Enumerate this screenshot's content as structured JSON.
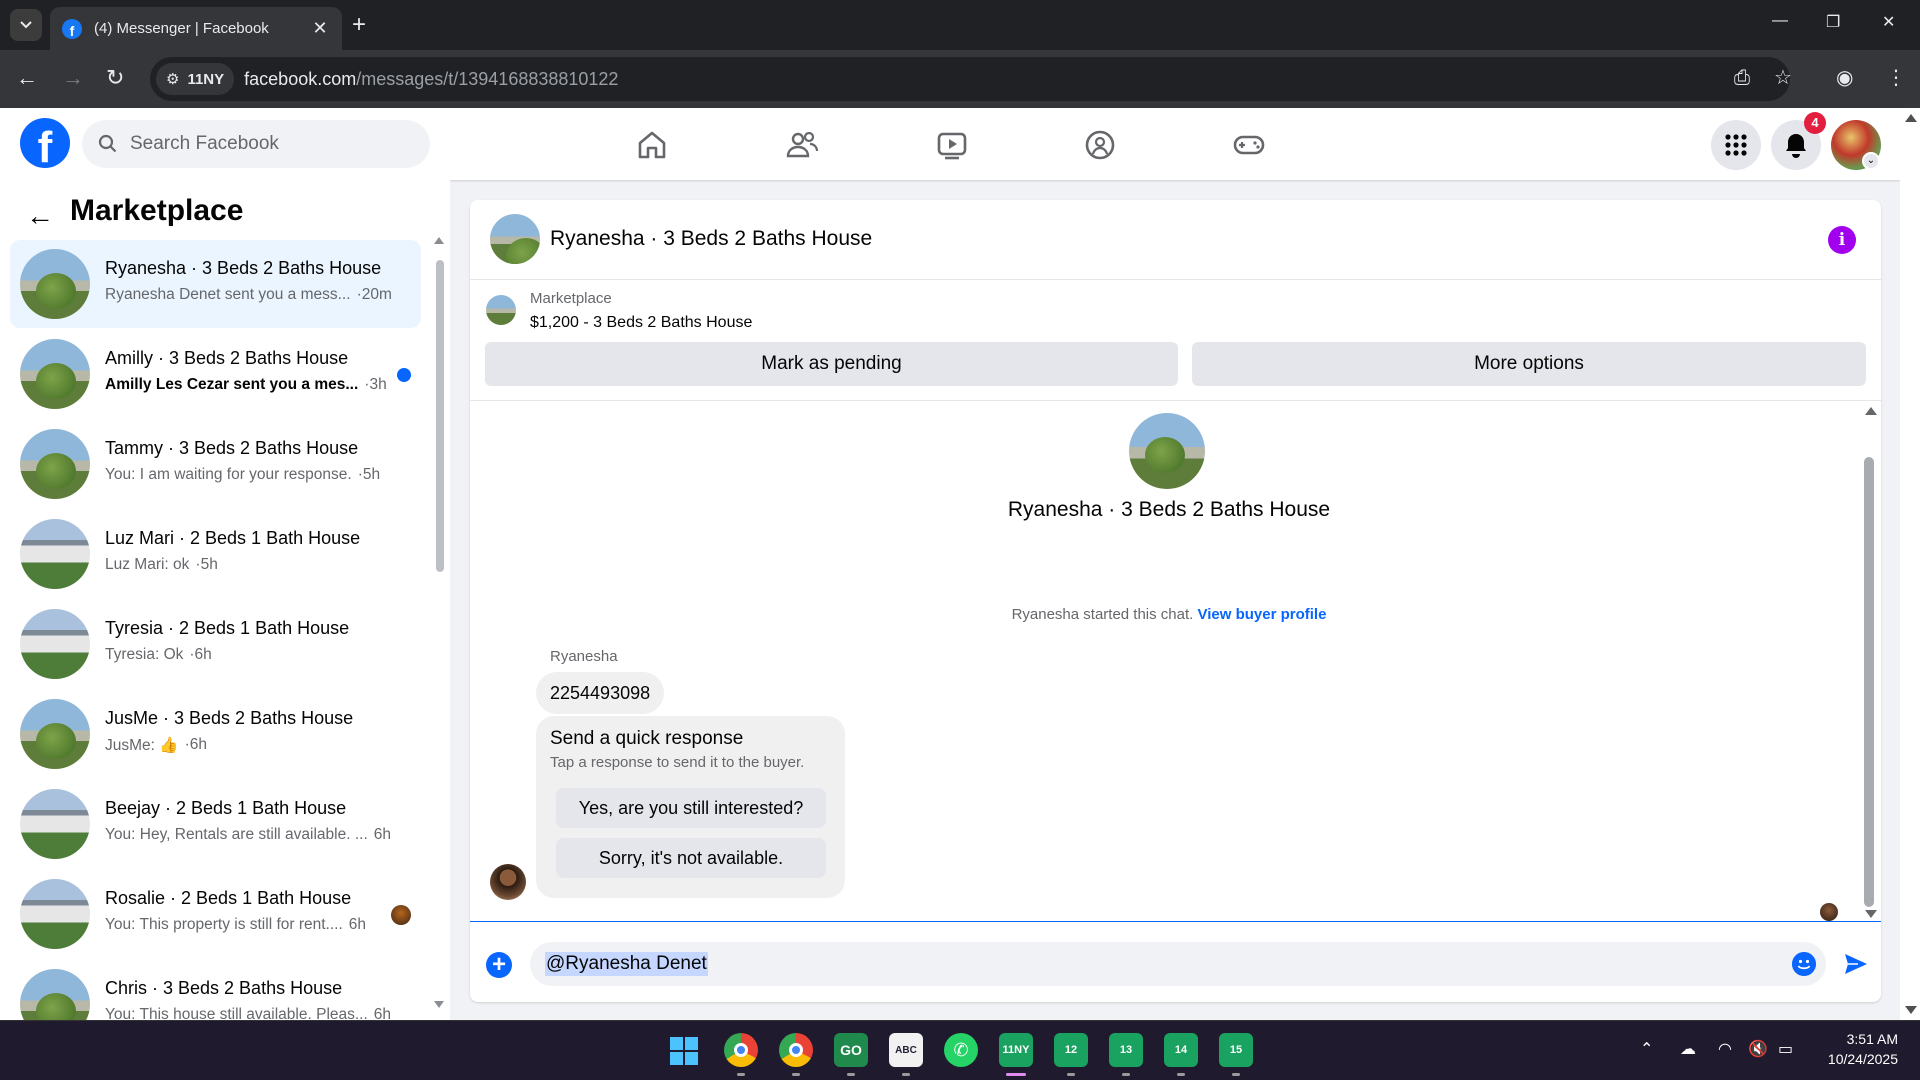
{
  "browser": {
    "tab_title": "(4) Messenger | Facebook",
    "site_chip": "11NY",
    "url_host": "facebook.com",
    "url_path": "/messages/t/1394168838810122"
  },
  "fb": {
    "search_placeholder": "Search Facebook",
    "notifications_count": "4"
  },
  "sidebar": {
    "title": "Marketplace",
    "conversations": [
      {
        "name": "Ryanesha · 3 Beds 2 Baths House",
        "snippet": "Ryanesha Denet sent you a mess...",
        "time": "·20m",
        "avatar": "bush",
        "selected": true
      },
      {
        "name": "Amilly · 3 Beds 2 Baths House",
        "snippet": "Amilly Les Cezar sent you a mes...",
        "time": "·3h",
        "avatar": "bush",
        "unread": true
      },
      {
        "name": "Tammy · 3 Beds 2 Baths House",
        "snippet": "You: I am waiting for your response.",
        "time": "·5h",
        "avatar": "bush"
      },
      {
        "name": "Luz Mari · 2 Beds 1 Bath House",
        "snippet": "Luz Mari: ok",
        "time": "·5h",
        "avatar": "house"
      },
      {
        "name": "Tyresia · 2 Beds 1 Bath House",
        "snippet": "Tyresia: Ok",
        "time": "·6h",
        "avatar": "house"
      },
      {
        "name": "JusMe · 3 Beds 2 Baths House",
        "snippet": "JusMe: 👍",
        "time": "·6h",
        "avatar": "bush"
      },
      {
        "name": "Beejay · 2 Beds 1 Bath House",
        "snippet": "You: Hey, Rentals are still available. ...",
        "time": "6h",
        "avatar": "house"
      },
      {
        "name": "Rosalie · 2 Beds 1 Bath House",
        "snippet": "You: This property is still for rent....",
        "time": "6h",
        "avatar": "house"
      },
      {
        "name": "Chris · 3 Beds 2 Baths House",
        "snippet": "You: This house still available. Pleas...",
        "time": "6h",
        "avatar": "bush"
      }
    ]
  },
  "chat": {
    "title": "Ryanesha · 3 Beds 2 Baths House",
    "marketplace_label": "Marketplace",
    "listing": "$1,200 - 3 Beds 2 Baths House",
    "mark_pending": "Mark as pending",
    "more_options": "More options",
    "hero_name": "Ryanesha · 3 Beds 2 Baths House",
    "started_text": "Ryanesha started this chat.",
    "view_buyer": "View buyer profile",
    "sender": "Ryanesha",
    "message": "2254493098",
    "quick_title": "Send a quick response",
    "quick_sub": "Tap a response to send it to the buyer.",
    "quick_1": "Yes, are you still interested?",
    "quick_2": "Sorry, it's not available.",
    "composer_value": "@Ryanesha Denet"
  },
  "taskbar": {
    "apps": [
      "11NY",
      "12",
      "13",
      "14",
      "15"
    ],
    "time": "3:51 AM",
    "date": "10/24/2025"
  }
}
